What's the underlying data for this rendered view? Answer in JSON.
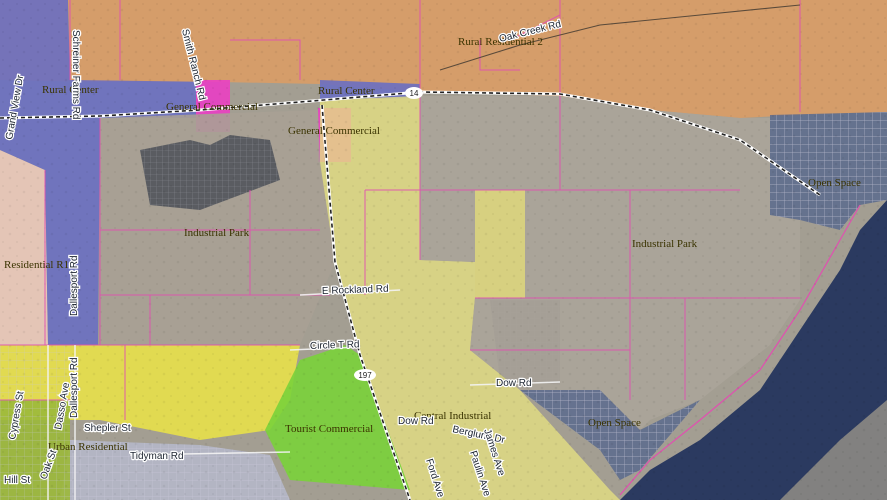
{
  "map": {
    "colors": {
      "rural_residential": "#d89d68",
      "rural_center": "#6a6fc2",
      "general_commercial": "#e844c0",
      "industrial_park": "#a8a095",
      "residential": "#e8c7b8",
      "tourist_commercial": "#7ad13a",
      "central_industrial": "#e4df82",
      "yellow_zone": "#e8e04a",
      "open_space": "#5b6a8d",
      "river": "#2b3a60",
      "parcel_line": "#e050b0"
    },
    "zone_labels": {
      "rural_residential_2": "Rural Residential 2",
      "rural_center_west": "Rural Center",
      "rural_center_east": "Rural Center",
      "general_commercial_1": "General Commercial",
      "general_commercial_2": "General Commercial",
      "industrial_park_west": "Industrial Park",
      "industrial_park_east": "Industrial Park",
      "residential_r1": "Residential R1",
      "open_space_north": "Open Space",
      "open_space_south": "Open Space",
      "central_industrial": "Central Industrial",
      "tourist_commercial": "Tourist Commercial",
      "urban_residential": "Urban Residential"
    },
    "road_labels": {
      "oak_creek_rd": "Oak Creek Rd",
      "smith_ranch_rd": "Smith Ranch Rd",
      "schreiner_farms_rd": "Schreiner Farms Rd",
      "grand_view_dr": "Grand View Dr",
      "dallesport_rd_1": "Dallesport Rd",
      "dallesport_rd_2": "Dallesport Rd",
      "e_rockland_rd": "E Rockland Rd",
      "circle_t_rd": "Circle T Rd",
      "dow_rd_1": "Dow Rd",
      "dow_rd_2": "Dow Rd",
      "cypress_st": "Cypress St",
      "oak_st": "Oak St",
      "dasso_ave": "Dasso Ave",
      "shepler_st": "Shepler St",
      "tidyman_rd": "Tidyman Rd",
      "hill_st": "Hill St",
      "berglund_dr": "Berglund Dr",
      "james_ave": "James Ave",
      "paulin_ave": "Paulin Ave",
      "ford_ave": "Ford Ave"
    },
    "shields": {
      "sr14": "14",
      "sr197": "197"
    }
  }
}
